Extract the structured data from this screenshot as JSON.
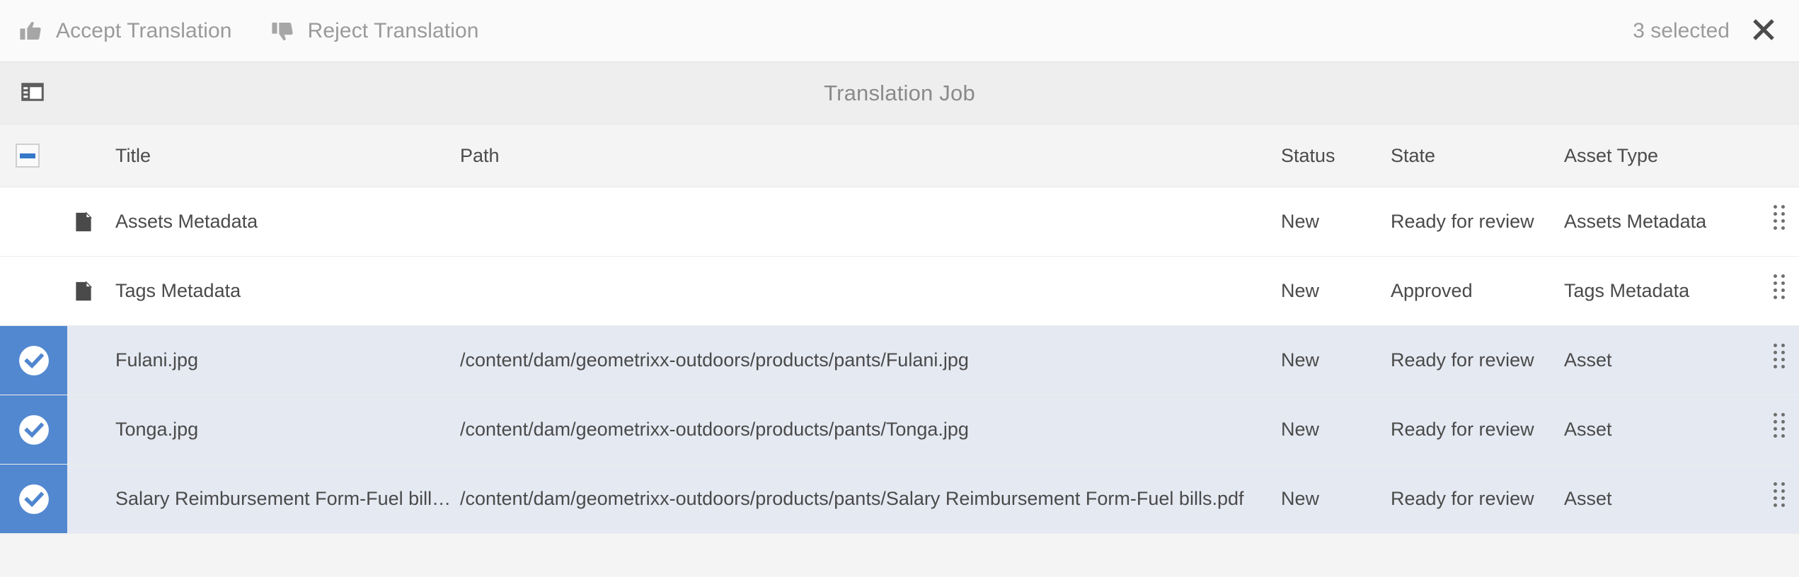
{
  "actionbar": {
    "accept_label": "Accept Translation",
    "accept_icon": "thumbs-up-icon",
    "reject_label": "Reject Translation",
    "reject_icon": "thumbs-down-icon",
    "selected_count_label": "3 selected",
    "close_icon": "close-icon",
    "disabled_text_color": "#9a9a9a"
  },
  "titleband": {
    "rail_toggle_icon": "rail-panel-icon",
    "title": "Translation Job"
  },
  "table": {
    "select_all_state": "indeterminate",
    "columns": [
      {
        "key": "title",
        "label": "Title"
      },
      {
        "key": "path",
        "label": "Path"
      },
      {
        "key": "status",
        "label": "Status"
      },
      {
        "key": "state",
        "label": "State"
      },
      {
        "key": "atype",
        "label": "Asset Type"
      }
    ],
    "accent_blue": "#5288d0",
    "selected_row_bg": "#e5e9f2",
    "rows": [
      {
        "selected": false,
        "icon": "document-icon",
        "title": "Assets Metadata",
        "path": "",
        "status": "New",
        "state": "Ready for review",
        "atype": "Assets Metadata",
        "grip_icon": "drag-handle-icon"
      },
      {
        "selected": false,
        "icon": "document-icon",
        "title": "Tags Metadata",
        "path": "",
        "status": "New",
        "state": "Approved",
        "atype": "Tags Metadata",
        "grip_icon": "drag-handle-icon"
      },
      {
        "selected": true,
        "icon": "check-circle-icon",
        "title": "Fulani.jpg",
        "path": "/content/dam/geometrixx-outdoors/products/pants/Fulani.jpg",
        "status": "New",
        "state": "Ready for review",
        "atype": "Asset",
        "grip_icon": "drag-handle-icon"
      },
      {
        "selected": true,
        "icon": "check-circle-icon",
        "title": "Tonga.jpg",
        "path": "/content/dam/geometrixx-outdoors/products/pants/Tonga.jpg",
        "status": "New",
        "state": "Ready for review",
        "atype": "Asset",
        "grip_icon": "drag-handle-icon"
      },
      {
        "selected": true,
        "icon": "check-circle-icon",
        "title": "Salary Reimbursement Form-Fuel bills.pdf",
        "path": "/content/dam/geometrixx-outdoors/products/pants/Salary Reimbursement Form-Fuel bills.pdf",
        "status": "New",
        "state": "Ready for review",
        "atype": "Asset",
        "grip_icon": "drag-handle-icon"
      }
    ]
  }
}
